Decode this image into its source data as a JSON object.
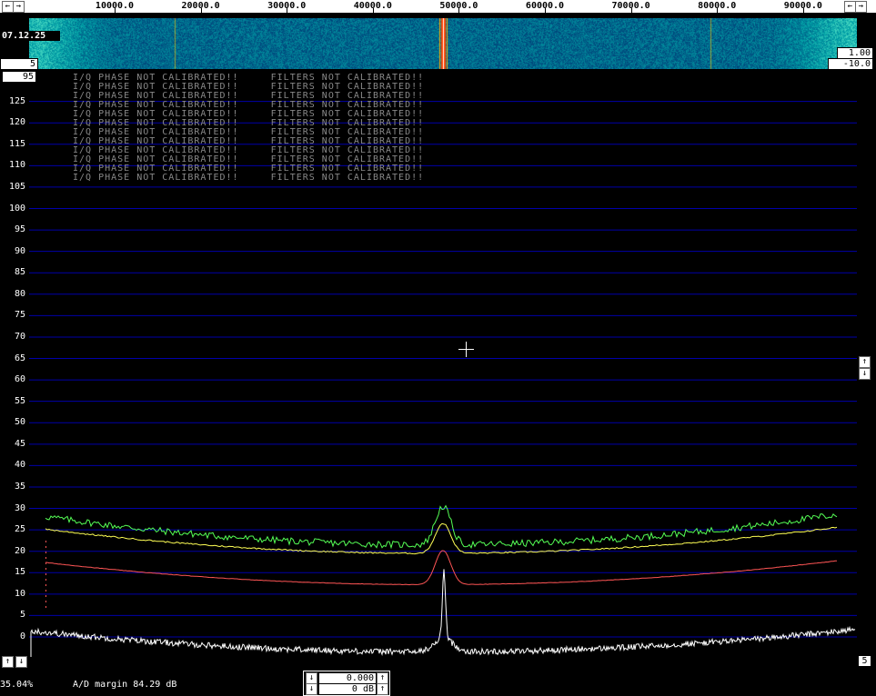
{
  "freq_axis": {
    "labels": [
      "10000.0",
      "20000.0",
      "30000.0",
      "40000.0",
      "50000.0",
      "60000.0",
      "70000.0",
      "80000.0",
      "90000.0"
    ],
    "left_arrow": "←",
    "right_arrow": "→",
    "left_arrow2": "→",
    "right_arrow2": "←"
  },
  "waterfall": {
    "date": "07.12.25",
    "left_value": "5",
    "right_top": "1.00",
    "right_bottom": "-10.0",
    "top_box": "95"
  },
  "y_axis": {
    "labels": [
      "125",
      "120",
      "115",
      "110",
      "105",
      "100",
      "95",
      "90",
      "85",
      "80",
      "75",
      "70",
      "65",
      "60",
      "55",
      "50",
      "45",
      "40",
      "35",
      "30",
      "25",
      "20",
      "15",
      "10",
      "5",
      "0"
    ]
  },
  "messages": [
    "I/Q PHASE NOT CALIBRATED!!     FILTERS NOT CALIBRATED!!",
    "I/Q PHASE NOT CALIBRATED!!     FILTERS NOT CALIBRATED!!",
    "I/Q PHASE NOT CALIBRATED!!     FILTERS NOT CALIBRATED!!",
    "I/Q PHASE NOT CALIBRATED!!     FILTERS NOT CALIBRATED!!",
    "I/Q PHASE NOT CALIBRATED!!     FILTERS NOT CALIBRATED!!",
    "I/Q PHASE NOT CALIBRATED!!     FILTERS NOT CALIBRATED!!",
    "I/Q PHASE NOT CALIBRATED!!     FILTERS NOT CALIBRATED!!",
    "I/Q PHASE NOT CALIBRATED!!     FILTERS NOT CALIBRATED!!",
    "I/Q PHASE NOT CALIBRATED!!     FILTERS NOT CALIBRATED!!",
    "I/Q PHASE NOT CALIBRATED!!     FILTERS NOT CALIBRATED!!",
    "I/Q PHASE NOT CALIBRATED!!     FILTERS NOT CALIBRATED!!",
    "I/Q PHASE NOT CALIBRATED!!     FILTERS NOT CALIBRATED!!"
  ],
  "right_controls": {
    "up": "↑",
    "down": "↓",
    "value": "5"
  },
  "bottom": {
    "percent": "35.04%",
    "ad_margin": "A/D margin 84.29 dB",
    "gain_value": "0.000",
    "db_value": "0 dB",
    "up": "↑",
    "down": "↓"
  },
  "colors": {
    "green": "#55ff55",
    "yellow": "#ffff55",
    "red": "#ff5555",
    "white": "#ffffff",
    "grid": "#0000aa"
  }
}
